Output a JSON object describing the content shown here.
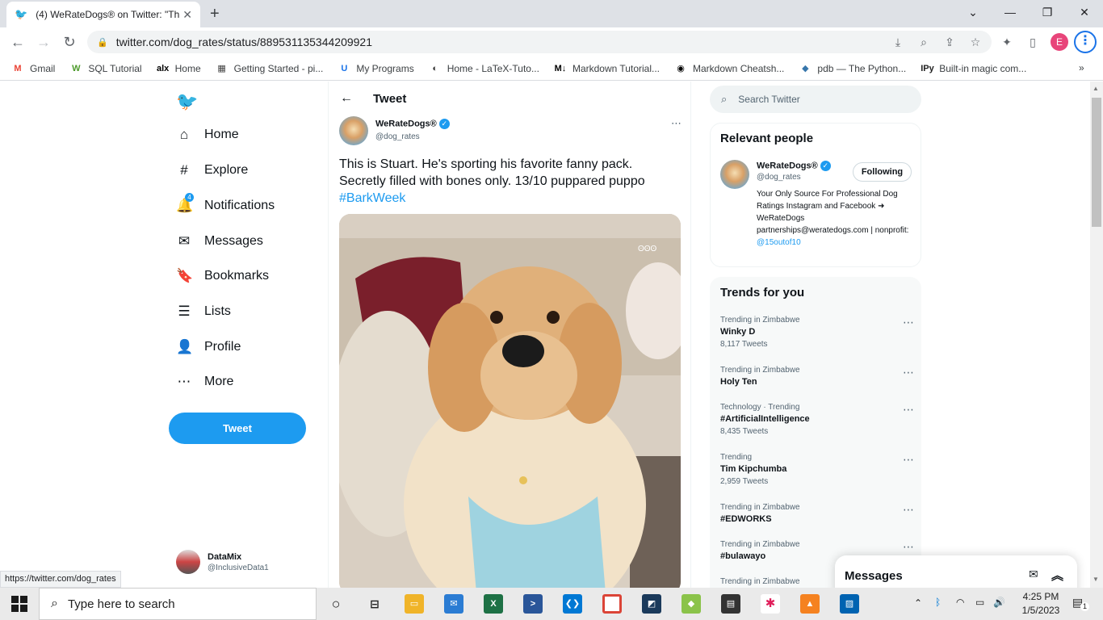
{
  "browser": {
    "tab_title": "(4) WeRateDogs® on Twitter: \"Th",
    "url": "twitter.com/dog_rates/status/889531135344209921",
    "profile_initial": "E",
    "bookmarks": [
      {
        "label": "Gmail",
        "icon": "M",
        "color": "#ea4335"
      },
      {
        "label": "SQL Tutorial",
        "icon": "W",
        "color": "#4c9a2a"
      },
      {
        "label": "Home",
        "icon": "alx",
        "color": "#000000"
      },
      {
        "label": "Getting Started - pi...",
        "icon": "▦",
        "color": "#444444"
      },
      {
        "label": "My Programs",
        "icon": "U",
        "color": "#1a73e8"
      },
      {
        "label": "Home - LaTeX-Tuto...",
        "icon": "◐",
        "color": "#333333"
      },
      {
        "label": "Markdown Tutorial...",
        "icon": "M↓",
        "color": "#000000"
      },
      {
        "label": "Markdown Cheatsh...",
        "icon": "◉",
        "color": "#000000"
      },
      {
        "label": "pdb — The Python...",
        "icon": "◆",
        "color": "#3776ab"
      },
      {
        "label": "Built-in magic com...",
        "icon": "IPy",
        "color": "#222222"
      }
    ]
  },
  "sidebar": {
    "items": [
      {
        "label": "Home",
        "icon": "⌂"
      },
      {
        "label": "Explore",
        "icon": "#"
      },
      {
        "label": "Notifications",
        "icon": "🔔",
        "badge": "4"
      },
      {
        "label": "Messages",
        "icon": "✉"
      },
      {
        "label": "Bookmarks",
        "icon": "🔖"
      },
      {
        "label": "Lists",
        "icon": "☰"
      },
      {
        "label": "Profile",
        "icon": "👤"
      },
      {
        "label": "More",
        "icon": "⋯"
      }
    ],
    "tweet_button": "Tweet",
    "account": {
      "name": "DataMix",
      "handle": "@InclusiveData1"
    }
  },
  "tweet": {
    "header": "Tweet",
    "author_name": "WeRateDogs®",
    "author_handle": "@dog_rates",
    "text_line1": "This is Stuart. He's sporting his favorite fanny pack.",
    "text_line2": "Secretly filled with bones only. 13/10 puppared puppo",
    "hashtag": "#BarkWeek",
    "photo_watermark": "ʘʘʘ"
  },
  "right": {
    "search_placeholder": "Search Twitter",
    "relevant_people": {
      "title": "Relevant people",
      "name": "WeRateDogs®",
      "handle": "@dog_rates",
      "follow_label": "Following",
      "bio": "Your Only Source For Professional Dog Ratings Instagram and Facebook ➜ WeRateDogs partnerships@weratedogs.com | nonprofit:",
      "bio_link": "@15outof10"
    },
    "trends": {
      "title": "Trends for you",
      "items": [
        {
          "context": "Trending in Zimbabwe",
          "name": "Winky D",
          "count": "8,117 Tweets"
        },
        {
          "context": "Trending in Zimbabwe",
          "name": "Holy Ten",
          "count": ""
        },
        {
          "context": "Technology · Trending",
          "name": "#ArtificialIntelligence",
          "count": "8,435 Tweets"
        },
        {
          "context": "Trending",
          "name": "Tim Kipchumba",
          "count": "2,959 Tweets"
        },
        {
          "context": "Trending in Zimbabwe",
          "name": "#EDWORKS",
          "count": ""
        },
        {
          "context": "Trending in Zimbabwe",
          "name": "#bulawayo",
          "count": ""
        },
        {
          "context": "Trending in Zimbabwe",
          "name": "",
          "count": ""
        }
      ]
    },
    "messages_drawer": "Messages"
  },
  "status_url": "https://twitter.com/dog_rates",
  "taskbar": {
    "search_placeholder": "Type here to search",
    "time": "4:25 PM",
    "date": "1/5/2023",
    "notification_count": "1"
  },
  "colors": {
    "accent": "#1d9bf0",
    "text": "#0f1419",
    "muted": "#536471"
  }
}
